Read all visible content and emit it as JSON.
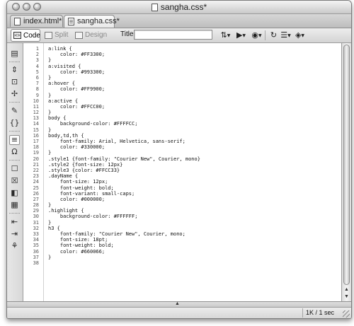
{
  "window": {
    "title": "sangha.css*"
  },
  "tabs": [
    {
      "label": "index.html*"
    },
    {
      "label": "sangha.css*"
    }
  ],
  "toolbar": {
    "code_label": "Code",
    "split_label": "Split",
    "design_label": "Design",
    "title_label": "Title:",
    "title_value": "",
    "icons": [
      "file-management-icon",
      "preview-icon",
      "globe-icon",
      "refresh-icon",
      "view-options-icon",
      "visual-aids-icon"
    ]
  },
  "left_toolbar": {
    "icons": [
      "open-documents-icon",
      "collapse-full-tag-icon",
      "collapse-selection-icon",
      "expand-all-icon",
      "select-parent-tag-icon",
      "balance-braces-icon",
      "line-numbers-icon",
      "highlight-invalid-code-icon",
      "apply-comment-icon",
      "remove-comment-icon",
      "wrap-tag-icon",
      "recent-snippets-icon",
      "move-css-icon",
      "indent-code-icon",
      "outdent-code-icon",
      "format-source-code-icon"
    ]
  },
  "code_lines": [
    "a:link {",
    "    color: #FF3300;",
    "}",
    "a:visited {",
    "    color: #993300;",
    "}",
    "a:hover {",
    "    color: #FF9900;",
    "}",
    "a:active {",
    "    color: #FFCC00;",
    "}",
    "body {",
    "    background-color: #FFFFCC;",
    "}",
    "body,td,th {",
    "    font-family: Arial, Helvetica, sans-serif;",
    "    color: #330000;",
    "}",
    ".style1 {font-family: \"Courier New\", Courier, mono}",
    ".style2 {font-size: 12px}",
    ".style3 {color: #FFCC33}",
    ".dayName {",
    "    font-size: 12px;",
    "    font-weight: bold;",
    "    font-variant: small-caps;",
    "    color: #000000;",
    "}",
    ".highlight {",
    "    background-color: #FFFFFF;",
    "}",
    "h3 {",
    "    font-family: \"Courier New\", Courier, mono;",
    "    font-size: 18pt;",
    "    font-weight: bold;",
    "    color: #660066;",
    "}",
    ""
  ],
  "status": {
    "download": "1K / 1 sec"
  }
}
